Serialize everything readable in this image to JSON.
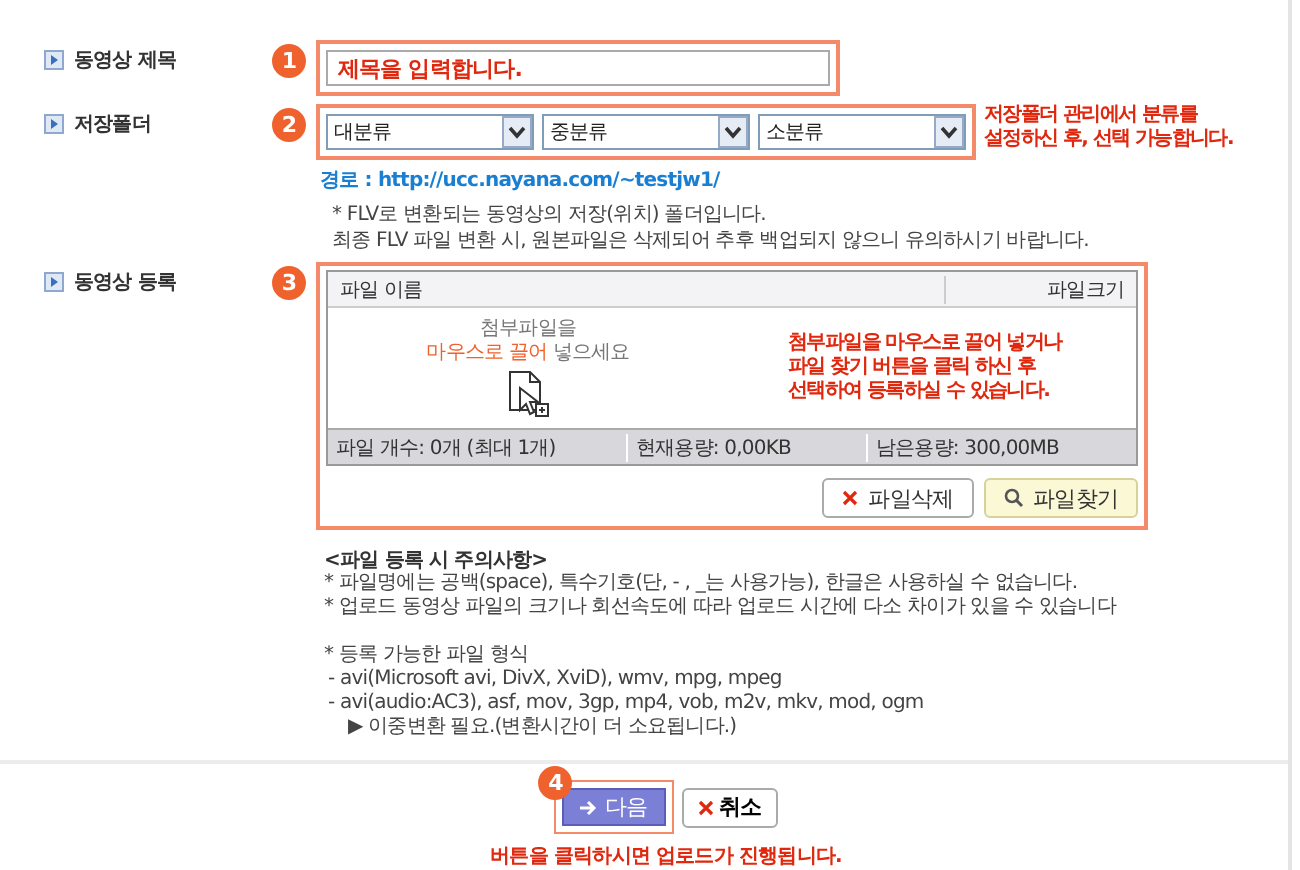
{
  "title_row": {
    "label": "동영상 제목",
    "step": "1",
    "value": "제목을 입력합니다."
  },
  "folder_row": {
    "label": "저장폴더",
    "step": "2",
    "selects": [
      "대분류",
      "중분류",
      "소분류"
    ],
    "hint": [
      "저장폴더 관리에서 분류를",
      "설정하신 후, 선택 가능합니다."
    ],
    "path": "경로 : http://ucc.nayana.com/~testjw1/",
    "notes": [
      "* FLV로 변환되는 동영상의 저장(위치) 폴더입니다.",
      "최종 FLV 파일 변환 시, 원본파일은 삭제되어 추후 백업되지 않으니 유의하시기 바랍니다."
    ]
  },
  "upload_row": {
    "label": "동영상 등록",
    "step": "3",
    "columns": [
      "파일 이름",
      "파일크기"
    ],
    "drop_hint": {
      "line": "첨부파일을",
      "accent": "마우스로 끌어",
      "rest": "넣으세요"
    },
    "hint": [
      "첨부파일을 마우스로 끌어 넣거나",
      "파일 찾기 버튼을 클릭 하신 후",
      "선택하여 등록하실 수 있습니다."
    ],
    "status": [
      "파일 개수: 0개 (최대 1개)",
      "현재용량: 0,00KB",
      "남은용량: 300,00MB"
    ],
    "buttons": [
      {
        "label": "파일삭제",
        "kind": "delete"
      },
      {
        "label": "파일찾기",
        "kind": "find"
      }
    ]
  },
  "notice": {
    "title": "<파일 등록 시 주의사항>",
    "groups": [
      [
        "* 파일명에는 공백(space), 특수기호(단, - , _는 사용가능), 한글은 사용하실 수 없습니다.",
        "* 업로드 동영상 파일의 크기나 회선속도에 따라 업로드 시간에 다소 차이가 있을 수 있습니다"
      ],
      [
        "* 등록 가능한 파일 형식",
        "- avi(Microsoft avi, DivX, XviD), wmv, mpg, mpeg",
        "- avi(audio:AC3), asf, mov, 3gp, mp4, vob, m2v, mkv, mod, ogm",
        "▶ 이중변환 필요.(변환시간이 더 소요됩니다.)"
      ]
    ]
  },
  "footer": {
    "step": "4",
    "buttons": [
      {
        "label": "다음",
        "kind": "next"
      },
      {
        "label": "취소",
        "kind": "cancel"
      }
    ],
    "hint": "버튼을 클릭하시면 업로드가 진행됩니다."
  }
}
